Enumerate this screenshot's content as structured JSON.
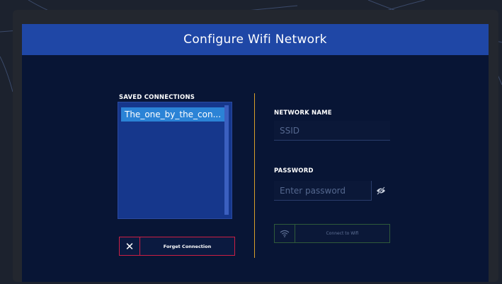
{
  "header": {
    "title": "Configure Wifi Network"
  },
  "saved": {
    "label": "SAVED CONNECTIONS",
    "items": [
      "The_one_by_the_con..."
    ],
    "forget_label": "Forget Connection"
  },
  "network": {
    "name_label": "NETWORK NAME",
    "name_placeholder": "SSID",
    "password_label": "PASSWORD",
    "password_placeholder": "Enter password",
    "connect_label": "Connect to Wifi"
  },
  "icons": {
    "forget": "close-icon",
    "password_toggle": "eye-off-icon",
    "connect": "wifi-icon"
  },
  "colors": {
    "header": "#1f47a6",
    "selected_item": "#2b83d6",
    "forget_border": "#cc1f44",
    "divider": "#d9a02a",
    "connect_border": "#2f5a3a"
  }
}
